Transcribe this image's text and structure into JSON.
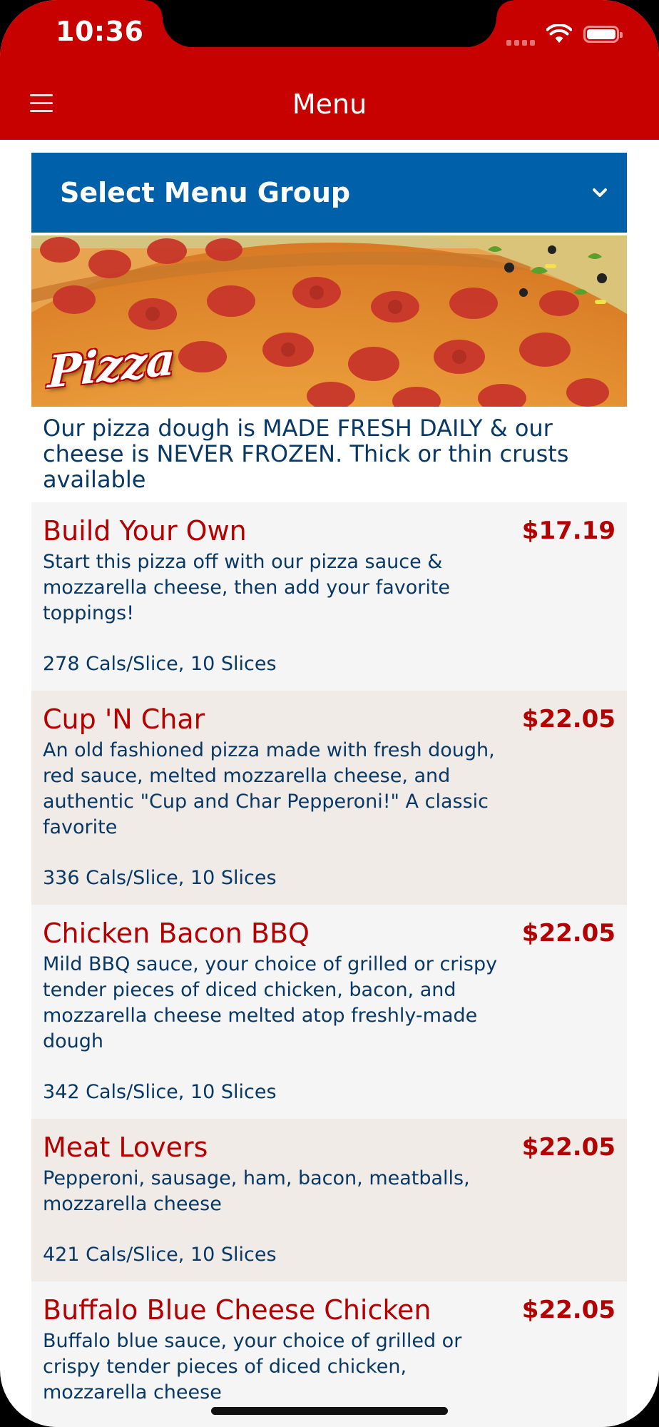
{
  "status_bar": {
    "time": "10:36"
  },
  "nav": {
    "title": "Menu"
  },
  "menu_group": {
    "label": "Select Menu Group"
  },
  "banner": {
    "label": "Pizza"
  },
  "intro": "Our pizza dough is MADE FRESH DAILY & our cheese is NEVER FROZEN. Thick or thin crusts available",
  "items": [
    {
      "name": "Build Your Own",
      "price": "$17.19",
      "description": "Start this pizza off with our pizza sauce & mozzarella cheese, then add your favorite toppings!",
      "calories": "278 Cals/Slice, 10 Slices"
    },
    {
      "name": "Cup 'N Char",
      "price": "$22.05",
      "description": "An old fashioned pizza made with fresh dough, red sauce, melted mozzarella cheese, and authentic \"Cup and Char Pepperoni!\" A classic favorite",
      "calories": "336 Cals/Slice, 10 Slices"
    },
    {
      "name": "Chicken Bacon BBQ",
      "price": "$22.05",
      "description": "Mild BBQ sauce, your choice of grilled or crispy tender pieces of diced chicken, bacon, and mozzarella cheese melted atop freshly-made dough",
      "calories": "342 Cals/Slice, 10 Slices"
    },
    {
      "name": "Meat Lovers",
      "price": "$22.05",
      "description": "Pepperoni, sausage, ham, bacon, meatballs, mozzarella cheese",
      "calories": "421 Cals/Slice, 10 Slices"
    },
    {
      "name": "Buffalo Blue Cheese Chicken",
      "price": "$22.05",
      "description": "Buffalo blue sauce, your choice of grilled or crispy tender pieces of diced chicken, mozzarella cheese",
      "calories": ""
    }
  ],
  "colors": {
    "header_red": "#c70000",
    "group_blue": "#0060a9",
    "item_red": "#b30000",
    "text_navy": "#083866"
  },
  "icons": {
    "menu": "hamburger-icon",
    "dropdown": "chevron-down-icon",
    "signal": "cellular-signal-icon",
    "wifi": "wifi-icon",
    "battery": "battery-icon"
  }
}
